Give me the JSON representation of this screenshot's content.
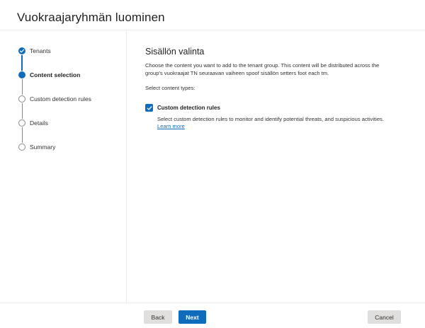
{
  "header": {
    "title": "Vuokraajaryhmän luominen"
  },
  "stepper": {
    "steps": [
      {
        "label": "Tenants",
        "state": "done",
        "icon": "check-icon"
      },
      {
        "label": "Content selection",
        "state": "current",
        "icon": "filled-circle-icon"
      },
      {
        "label": "Custom detection rules",
        "state": "todo",
        "icon": "empty-circle-icon"
      },
      {
        "label": "Details",
        "state": "todo",
        "icon": "empty-circle-icon"
      },
      {
        "label": "Summary",
        "state": "todo",
        "icon": "empty-circle-icon"
      }
    ]
  },
  "main": {
    "section_title": "Sisällön valinta",
    "description_line1": "Choose the content you want to add to the tenant group. This content will be distributed across the",
    "description_line2": "group's vuokraajat TN seuraavan vaiheen spoof sisällön setters foot each tm.",
    "select_label": "Select content types:",
    "content_type": {
      "checked": true,
      "label": "Custom detection rules",
      "description": "Select custom detection rules to monitor and identify potential threats, and suspicious activities.",
      "link": "Learn more"
    }
  },
  "footer": {
    "back_label": "Back",
    "next_label": "Next",
    "cancel_label": "Cancel"
  },
  "colors": {
    "accent": "#0f6cbd",
    "secondary_button": "#e1dfdd",
    "divider": "#edebe9"
  }
}
